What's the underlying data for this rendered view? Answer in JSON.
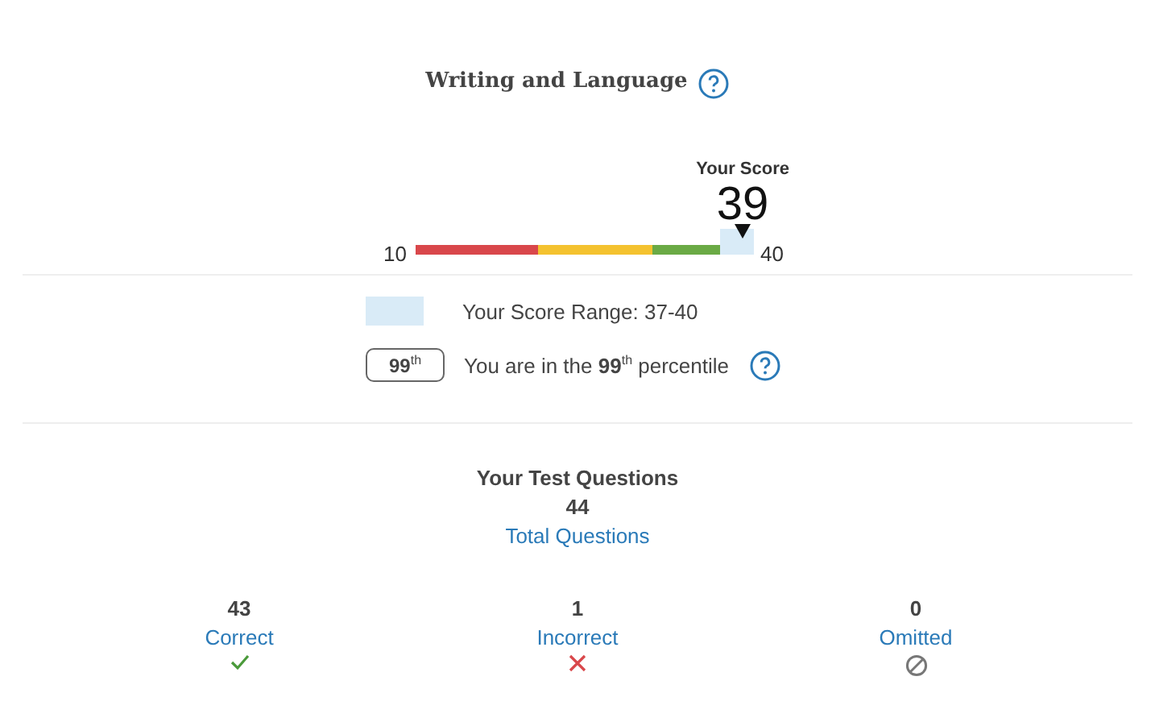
{
  "section": {
    "title": "Writing and Language"
  },
  "score": {
    "label": "Your Score",
    "value": "39",
    "min": "10",
    "max": "40",
    "level": 0.967
  },
  "range": {
    "text": "Your Score Range: 37-40",
    "level": 0.1
  },
  "percentile": {
    "badge": "99$^{th}$",
    "text": "You are in the **99**$^{th}$ percentile"
  },
  "questions": {
    "title": "Your Test Questions",
    "total": "44",
    "total_label": "Total Questions",
    "breakdown": [
      {
        "count": "43",
        "label": "Correct",
        "kind": "correct"
      },
      {
        "count": "1",
        "label": "Incorrect",
        "kind": "incorrect"
      },
      {
        "count": "0",
        "label": "Omitted",
        "kind": "omitted"
      }
    ]
  }
}
